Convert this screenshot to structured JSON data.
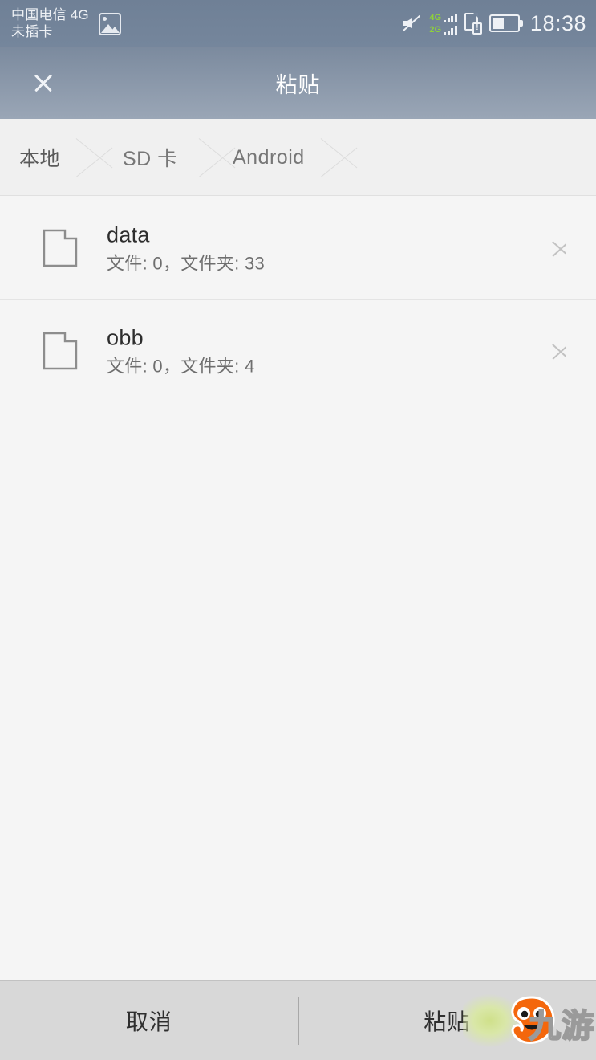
{
  "statusbar": {
    "carrier_line1": "中国电信 4G",
    "carrier_line2": "未插卡",
    "picture_icon": "picture-icon",
    "mute_icon": "mute-icon",
    "signal_4g_label": "4G",
    "signal_2g_label": "2G",
    "sim_icon": "sim-alert-icon",
    "sim_badge": "!",
    "battery_icon": "battery-icon",
    "time": "18:38"
  },
  "titlebar": {
    "close_icon": "close-icon",
    "title": "粘贴"
  },
  "breadcrumb": {
    "items": [
      {
        "label": "本地"
      },
      {
        "label": "SD 卡"
      },
      {
        "label": "Android"
      }
    ]
  },
  "list": {
    "rows": [
      {
        "icon": "folder-icon",
        "name": "data",
        "meta": "文件: 0，文件夹: 33",
        "chevron": "chevron-right-icon"
      },
      {
        "icon": "folder-icon",
        "name": "obb",
        "meta": "文件: 0，文件夹: 4",
        "chevron": "chevron-right-icon"
      }
    ]
  },
  "bottombar": {
    "cancel_label": "取消",
    "paste_label": "粘贴"
  },
  "watermark": {
    "text": "九游"
  },
  "colors": {
    "statusbar_top": "#6f8096",
    "titlebar_bottom": "#9aa6b6",
    "breadcrumb_bg": "#f0f0f0",
    "content_bg": "#f5f5f5",
    "bottombar_bg": "#d8d8d8",
    "signal_green": "#8ed13a",
    "watermark_orange": "#f4670c",
    "watermark_green": "#cfe08a"
  }
}
